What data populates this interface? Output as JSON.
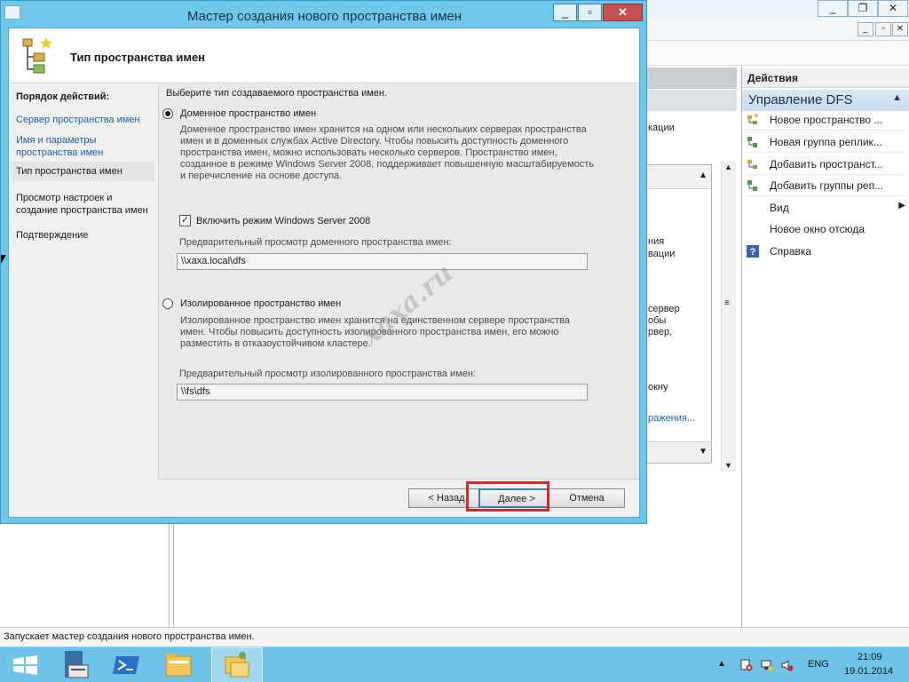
{
  "background": {
    "mdi_controls": [
      "_",
      "▫",
      "✕"
    ],
    "center_fragments": [
      "кации",
      "ния",
      "вации",
      "сервер",
      "обы",
      "рвер,",
      "окну",
      "ражения..."
    ],
    "actions": {
      "header": "Действия",
      "section_title": "Управление DFS",
      "items": [
        {
          "label": "Новое пространство ...",
          "icon": "namespace-icon"
        },
        {
          "label": "Новая группа реплик...",
          "icon": "replication-group-icon"
        },
        {
          "label": "Добавить пространст...",
          "icon": "add-namespace-icon"
        },
        {
          "label": "Добавить группы реп...",
          "icon": "add-replication-icon"
        },
        {
          "label": "Вид",
          "icon": ""
        },
        {
          "label": "Новое окно отсюда",
          "icon": ""
        },
        {
          "label": "Справка",
          "icon": "help-icon"
        }
      ]
    },
    "status_text": "Запускает мастер создания нового пространства имен."
  },
  "wizard": {
    "title": "Мастер создания нового пространства имен",
    "header_title": "Тип пространства имен",
    "steps_title": "Порядок действий:",
    "steps": [
      {
        "label": "Сервер пространства имен",
        "state": "link"
      },
      {
        "label": "Имя и параметры пространства имен",
        "state": "link"
      },
      {
        "label": "Тип пространства имен",
        "state": "active"
      },
      {
        "label": "Просмотр настроек и создание пространства имен",
        "state": "plain"
      },
      {
        "label": "Подтверждение",
        "state": "plain"
      }
    ],
    "prompt": "Выберите тип создаваемого пространства имен.",
    "domain_option": {
      "label": "Доменное пространство имен",
      "selected": true,
      "description": "Доменное пространство имен хранится на одном или нескольких серверах пространства имен и в доменных службах Active Directory. Чтобы повысить доступность доменного пространства имен, можно использовать несколько серверов. Пространство имен, созданное в режиме Windows Server 2008, поддерживает повышенную масштабируемость и перечисление на основе доступа.",
      "checkbox_label": "Включить режим Windows Server 2008",
      "checkbox_checked": true,
      "preview_label": "Предварительный просмотр доменного пространства имен:",
      "preview_value": "\\\\xaxa.local\\dfs"
    },
    "standalone_option": {
      "label": "Изолированное пространство имен",
      "selected": false,
      "description": "Изолированное пространство имен хранится на единственном сервере пространства имен. Чтобы повысить доступность изолированного пространства имен, его можно разместить в отказоустойчивом кластере.",
      "preview_label": "Предварительный просмотр изолированного пространства имен:",
      "preview_value": "\\\\fs\\dfs"
    },
    "buttons": {
      "back": "< Назад",
      "next": "Далее >",
      "cancel": "Отмена"
    }
  },
  "watermark": "xaxa.ru",
  "taskbar": {
    "apps": [
      "start-button",
      "server-manager",
      "powershell",
      "file-explorer",
      "dfs-management"
    ],
    "language": "ENG",
    "time": "21:09",
    "date": "19.01.2014"
  }
}
